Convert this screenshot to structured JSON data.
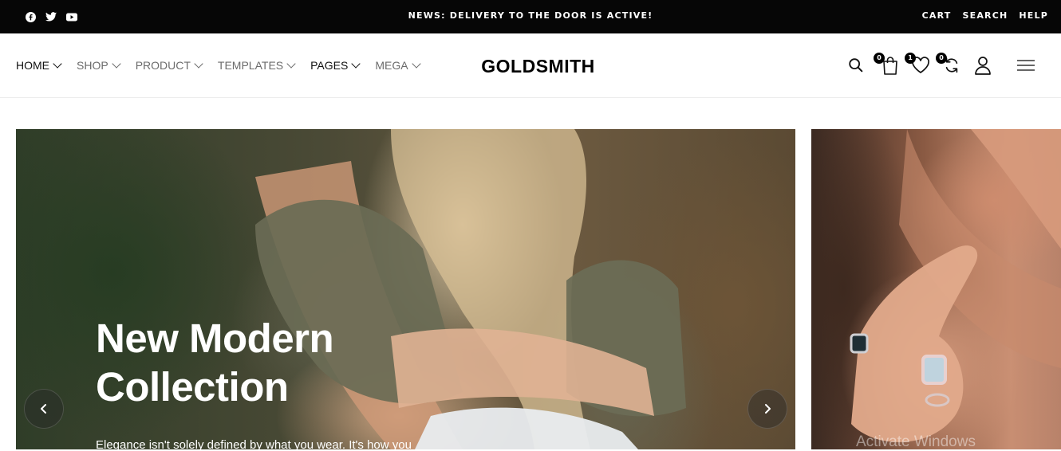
{
  "topbar": {
    "social_icons": [
      "facebook-icon",
      "twitter-icon",
      "youtube-icon"
    ],
    "news": "NEWS: DELIVERY TO THE DOOR IS ACTIVE!",
    "links": {
      "cart": "CART",
      "search": "SEARCH",
      "help": "HELP"
    }
  },
  "header": {
    "nav": [
      {
        "label": "HOME"
      },
      {
        "label": "SHOP"
      },
      {
        "label": "PRODUCT"
      },
      {
        "label": "TEMPLATES"
      },
      {
        "label": "PAGES"
      },
      {
        "label": "MEGA"
      }
    ],
    "logo": "GOLDSMITH",
    "icons": {
      "search": "search-icon",
      "cart": "shopping-bag-icon",
      "cart_count": "0",
      "wishlist": "heart-icon",
      "wishlist_count": "1",
      "compare": "refresh-icon",
      "compare_count": "0",
      "account": "user-icon",
      "menu": "hamburger-menu-icon"
    }
  },
  "hero": {
    "title": "New Modern\nCollection",
    "text": "Elegance isn't solely defined by what you wear. It's how you",
    "prev_icon": "chevron-left-icon",
    "next_icon": "chevron-right-icon"
  },
  "watermark": "Activate Windows",
  "colors": {
    "topbar_bg": "#060606",
    "text_dark": "#111111",
    "nav_muted": "#6b6b6b"
  }
}
